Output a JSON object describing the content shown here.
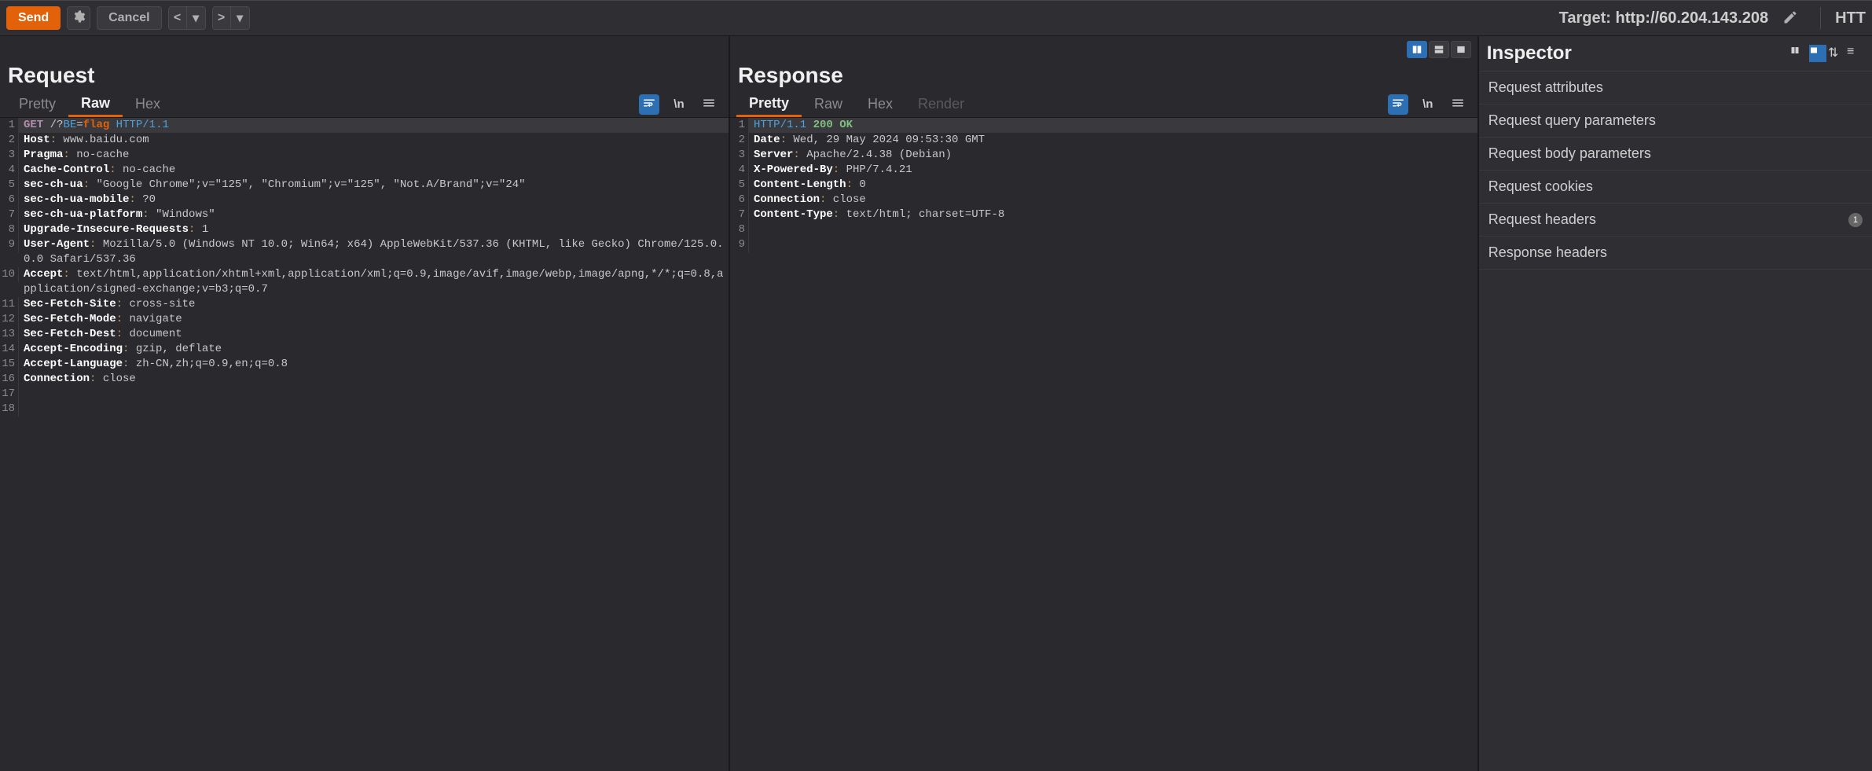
{
  "toolbar": {
    "send": "Send",
    "cancel": "Cancel",
    "target_label": "Target:",
    "target_url": "http://60.204.143.208",
    "protocol": "HTT"
  },
  "request": {
    "title": "Request",
    "tabs": {
      "pretty": "Pretty",
      "raw": "Raw",
      "hex": "Hex"
    },
    "active_tab": "raw",
    "lines": [
      {
        "n": 1,
        "segments": [
          {
            "t": "method",
            "v": "GET"
          },
          {
            "t": "val",
            "v": " "
          },
          {
            "t": "path",
            "v": "/?"
          },
          {
            "t": "query",
            "v": "BE"
          },
          {
            "t": "val",
            "v": "="
          },
          {
            "t": "flag",
            "v": "flag"
          },
          {
            "t": "val",
            "v": " "
          },
          {
            "t": "proto",
            "v": "HTTP/1.1"
          }
        ]
      },
      {
        "n": 2,
        "segments": [
          {
            "t": "key",
            "v": "Host"
          },
          {
            "t": "punct",
            "v": ": "
          },
          {
            "t": "val",
            "v": "www.baidu.com"
          }
        ]
      },
      {
        "n": 3,
        "segments": [
          {
            "t": "key",
            "v": "Pragma"
          },
          {
            "t": "punct",
            "v": ": "
          },
          {
            "t": "val",
            "v": "no-cache"
          }
        ]
      },
      {
        "n": 4,
        "segments": [
          {
            "t": "key",
            "v": "Cache-Control"
          },
          {
            "t": "punct",
            "v": ": "
          },
          {
            "t": "val",
            "v": "no-cache"
          }
        ]
      },
      {
        "n": 5,
        "segments": [
          {
            "t": "key",
            "v": "sec-ch-ua"
          },
          {
            "t": "punct",
            "v": ": "
          },
          {
            "t": "val",
            "v": "\"Google Chrome\";v=\"125\", \"Chromium\";v=\"125\", \"Not.A/Brand\";v=\"24\""
          }
        ]
      },
      {
        "n": 6,
        "segments": [
          {
            "t": "key",
            "v": "sec-ch-ua-mobile"
          },
          {
            "t": "punct",
            "v": ": "
          },
          {
            "t": "val",
            "v": "?0"
          }
        ]
      },
      {
        "n": 7,
        "segments": [
          {
            "t": "key",
            "v": "sec-ch-ua-platform"
          },
          {
            "t": "punct",
            "v": ": "
          },
          {
            "t": "val",
            "v": "\"Windows\""
          }
        ]
      },
      {
        "n": 8,
        "segments": [
          {
            "t": "key",
            "v": "Upgrade-Insecure-Requests"
          },
          {
            "t": "punct",
            "v": ": "
          },
          {
            "t": "val",
            "v": "1"
          }
        ]
      },
      {
        "n": 9,
        "segments": [
          {
            "t": "key",
            "v": "User-Agent"
          },
          {
            "t": "punct",
            "v": ": "
          },
          {
            "t": "val",
            "v": "Mozilla/5.0 (Windows NT 10.0; Win64; x64) AppleWebKit/537.36 (KHTML, like Gecko) Chrome/125.0.0.0 Safari/537.36"
          }
        ]
      },
      {
        "n": 10,
        "segments": [
          {
            "t": "key",
            "v": "Accept"
          },
          {
            "t": "punct",
            "v": ": "
          },
          {
            "t": "val",
            "v": "text/html,application/xhtml+xml,application/xml;q=0.9,image/avif,image/webp,image/apng,*/*;q=0.8,application/signed-exchange;v=b3;q=0.7"
          }
        ]
      },
      {
        "n": 11,
        "segments": [
          {
            "t": "key",
            "v": "Sec-Fetch-Site"
          },
          {
            "t": "punct",
            "v": ": "
          },
          {
            "t": "val",
            "v": "cross-site"
          }
        ]
      },
      {
        "n": 12,
        "segments": [
          {
            "t": "key",
            "v": "Sec-Fetch-Mode"
          },
          {
            "t": "punct",
            "v": ": "
          },
          {
            "t": "val",
            "v": "navigate"
          }
        ]
      },
      {
        "n": 13,
        "segments": [
          {
            "t": "key",
            "v": "Sec-Fetch-Dest"
          },
          {
            "t": "punct",
            "v": ": "
          },
          {
            "t": "val",
            "v": "document"
          }
        ]
      },
      {
        "n": 14,
        "segments": [
          {
            "t": "key",
            "v": "Accept-Encoding"
          },
          {
            "t": "punct",
            "v": ": "
          },
          {
            "t": "val",
            "v": "gzip, deflate"
          }
        ]
      },
      {
        "n": 15,
        "segments": [
          {
            "t": "key",
            "v": "Accept-Language"
          },
          {
            "t": "punct",
            "v": ": "
          },
          {
            "t": "val",
            "v": "zh-CN,zh;q=0.9,en;q=0.8"
          }
        ]
      },
      {
        "n": 16,
        "segments": [
          {
            "t": "key",
            "v": "Connection"
          },
          {
            "t": "punct",
            "v": ": "
          },
          {
            "t": "val",
            "v": "close"
          }
        ]
      },
      {
        "n": 17,
        "segments": []
      },
      {
        "n": 18,
        "segments": []
      }
    ]
  },
  "response": {
    "title": "Response",
    "tabs": {
      "pretty": "Pretty",
      "raw": "Raw",
      "hex": "Hex",
      "render": "Render"
    },
    "active_tab": "pretty",
    "lines": [
      {
        "n": 1,
        "segments": [
          {
            "t": "proto",
            "v": "HTTP/1.1"
          },
          {
            "t": "val",
            "v": " "
          },
          {
            "t": "status",
            "v": "200 OK"
          }
        ]
      },
      {
        "n": 2,
        "segments": [
          {
            "t": "key",
            "v": "Date"
          },
          {
            "t": "punct",
            "v": ": "
          },
          {
            "t": "val",
            "v": "Wed, 29 May 2024 09:53:30 GMT"
          }
        ]
      },
      {
        "n": 3,
        "segments": [
          {
            "t": "key",
            "v": "Server"
          },
          {
            "t": "punct",
            "v": ": "
          },
          {
            "t": "val",
            "v": "Apache/2.4.38 (Debian)"
          }
        ]
      },
      {
        "n": 4,
        "segments": [
          {
            "t": "key",
            "v": "X-Powered-By"
          },
          {
            "t": "punct",
            "v": ": "
          },
          {
            "t": "val",
            "v": "PHP/7.4.21"
          }
        ]
      },
      {
        "n": 5,
        "segments": [
          {
            "t": "key",
            "v": "Content-Length"
          },
          {
            "t": "punct",
            "v": ": "
          },
          {
            "t": "val",
            "v": "0"
          }
        ]
      },
      {
        "n": 6,
        "segments": [
          {
            "t": "key",
            "v": "Connection"
          },
          {
            "t": "punct",
            "v": ": "
          },
          {
            "t": "val",
            "v": "close"
          }
        ]
      },
      {
        "n": 7,
        "segments": [
          {
            "t": "key",
            "v": "Content-Type"
          },
          {
            "t": "punct",
            "v": ": "
          },
          {
            "t": "val",
            "v": "text/html; charset=UTF-8"
          }
        ]
      },
      {
        "n": 8,
        "segments": []
      },
      {
        "n": 9,
        "segments": []
      }
    ]
  },
  "inspector": {
    "title": "Inspector",
    "items": [
      {
        "label": "Request attributes"
      },
      {
        "label": "Request query parameters"
      },
      {
        "label": "Request body parameters"
      },
      {
        "label": "Request cookies"
      },
      {
        "label": "Request headers",
        "badge": "1"
      },
      {
        "label": "Response headers"
      }
    ]
  },
  "tool_labels": {
    "newline": "\\n"
  }
}
